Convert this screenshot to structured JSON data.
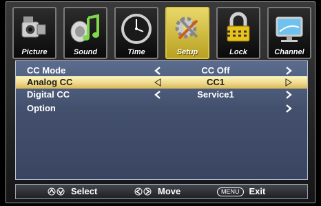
{
  "tabs": [
    {
      "label": "Picture",
      "icon": "camcorder-icon",
      "active": false
    },
    {
      "label": "Sound",
      "icon": "speaker-music-icon",
      "active": false
    },
    {
      "label": "Time",
      "icon": "clock-icon",
      "active": false
    },
    {
      "label": "Setup",
      "icon": "gear-tools-icon",
      "active": true
    },
    {
      "label": "Lock",
      "icon": "padlock-icon",
      "active": false
    },
    {
      "label": "Channel",
      "icon": "monitor-icon",
      "active": false
    }
  ],
  "menu": {
    "items": [
      {
        "label": "CC Mode",
        "value": "CC Off"
      },
      {
        "label": "Analog CC",
        "value": "CC1"
      },
      {
        "label": "Digital CC",
        "value": "Service1"
      },
      {
        "label": "Option",
        "value": ""
      }
    ],
    "selected_index": 1
  },
  "footer": {
    "select_label": "Select",
    "move_label": "Move",
    "menu_key": "MENU",
    "exit_label": "Exit"
  },
  "colors": {
    "panel": "#4c5a7a",
    "highlight": "#efd98a",
    "active_tab": "#d9c340"
  }
}
